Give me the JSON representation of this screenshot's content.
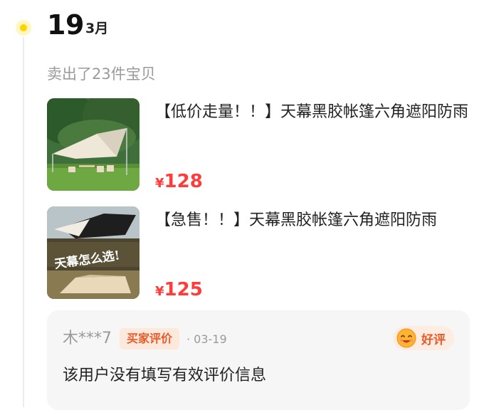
{
  "header": {
    "day": "19",
    "month": "3月",
    "sold_summary": "卖出了23件宝贝"
  },
  "products": [
    {
      "title": "【低价走量！！】天幕黑胶帐篷六角遮阳防雨",
      "currency": "¥",
      "price": "128",
      "image": "tent-canopy-on-lawn"
    },
    {
      "title": "【急售！！】天幕黑胶帐篷六角遮阳防雨",
      "currency": "¥",
      "price": "125",
      "image": "tent-canopy-collage",
      "image_caption": "天幕怎么选!"
    }
  ],
  "review": {
    "reviewer": "木***7",
    "badge": "买家评价",
    "date": "· 03-19",
    "rating": "好评",
    "rating_icon": "smile-face-icon",
    "content": "该用户没有填写有效评价信息"
  },
  "colors": {
    "accent_yellow": "#ffd400",
    "price_red": "#ff3b3b",
    "badge_orange": "#e85a2a"
  }
}
